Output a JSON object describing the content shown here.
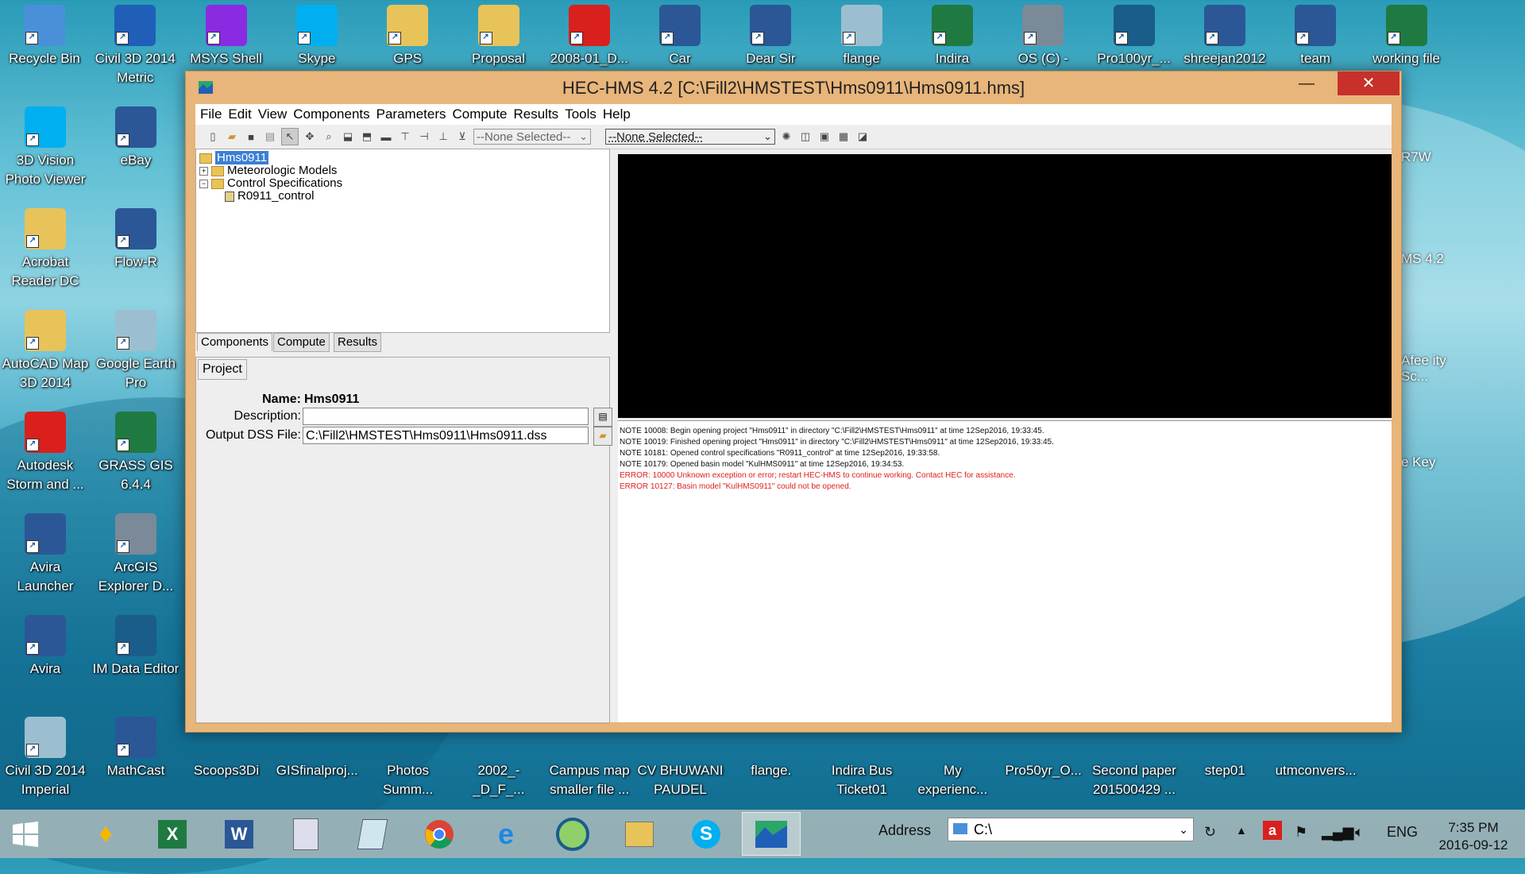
{
  "desktop": {
    "top_row": [
      "Recycle Bin",
      "Civil 3D 2014 Metric",
      "MSYS Shell",
      "Skype",
      "GPS",
      "Proposal",
      "2008-01_D...",
      "Car",
      "Dear Sir",
      "flange",
      "Indira",
      "OS (C) -",
      "Pro100yr_...",
      "shreejan2012",
      "team",
      "working file"
    ],
    "col1": [
      "3D Vision Photo Viewer",
      "Acrobat Reader DC",
      "AutoCAD Map 3D 2014",
      "Autodesk Storm and ...",
      "Avira Launcher",
      "Avira",
      "Civil 3D 2014 Imperial"
    ],
    "col2": [
      "eBay",
      "Flow-R",
      "Google Earth Pro",
      "GRASS GIS 6.4.4",
      "ArcGIS Explorer D...",
      "IM Data Editor",
      "MathCast"
    ],
    "right_partial": [
      "R7W",
      "MS 4.2",
      "Afee ity Sc...",
      "e Key"
    ],
    "bottom_row": [
      "Scoops3Di",
      "GISfinalproj...",
      "Photos Summ...",
      "2002_-_D_F_...",
      "Campus map smaller file ...",
      "CV BHUWANI PAUDEL",
      "flange.",
      "Indira Bus Ticket01",
      "My experienc...",
      "Pro50yr_O...",
      "Second paper 201500429 ...",
      "step01",
      "utmconvers..."
    ]
  },
  "window": {
    "title": "HEC-HMS 4.2 [C:\\Fill2\\HMSTEST\\Hms0911\\Hms0911.hms]",
    "minimize": "—",
    "maximize": "☐",
    "close": "✕"
  },
  "menu": [
    "File",
    "Edit",
    "View",
    "Components",
    "Parameters",
    "Compute",
    "Results",
    "Tools",
    "Help"
  ],
  "toolbar": {
    "combo1": "--None Selected--",
    "combo2": "--None Selected--"
  },
  "tree": {
    "root": "Hms0911",
    "meteorologic": "Meteorologic Models",
    "control": "Control Specifications",
    "control_child": "R0911_control"
  },
  "tabs": [
    "Components",
    "Compute",
    "Results"
  ],
  "props": {
    "tab": "Project",
    "name_label": "Name:",
    "name_value": "Hms0911",
    "desc_label": "Description:",
    "desc_value": "",
    "dss_label": "Output DSS File:",
    "dss_value": "C:\\Fill2\\HMSTEST\\Hms0911\\Hms0911.dss"
  },
  "log": [
    {
      "type": "note",
      "text": "NOTE 10008:  Begin opening project \"Hms0911\" in directory \"C:\\Fill2\\HMSTEST\\Hms0911\" at time 12Sep2016, 19:33:45."
    },
    {
      "type": "note",
      "text": "NOTE 10019:  Finished opening project \"Hms0911\" in directory \"C:\\Fill2\\HMSTEST\\Hms0911\" at time 12Sep2016, 19:33:45."
    },
    {
      "type": "note",
      "text": "NOTE 10181:  Opened control specifications \"R0911_control\" at time 12Sep2016, 19:33:58."
    },
    {
      "type": "note",
      "text": "NOTE 10179:  Opened basin model \"KulHMS0911\" at time 12Sep2016, 19:34:53."
    },
    {
      "type": "error",
      "text": "ERROR: 10000  Unknown exception or error; restart HEC-HMS to continue working.  Contact HEC for assistance."
    },
    {
      "type": "error",
      "text": "ERROR 10127:  Basin model \"KulHMS0911\" could not be opened."
    }
  ],
  "taskbar": {
    "address_label": "Address",
    "address_value": "C:\\",
    "language": "ENG",
    "time": "7:35 PM",
    "date": "2016-09-12"
  },
  "colors": {
    "window_frame": "#e8b57a",
    "close_button": "#c7302b",
    "error_text": "#e02020",
    "tree_selected": "#3b7fd4"
  }
}
